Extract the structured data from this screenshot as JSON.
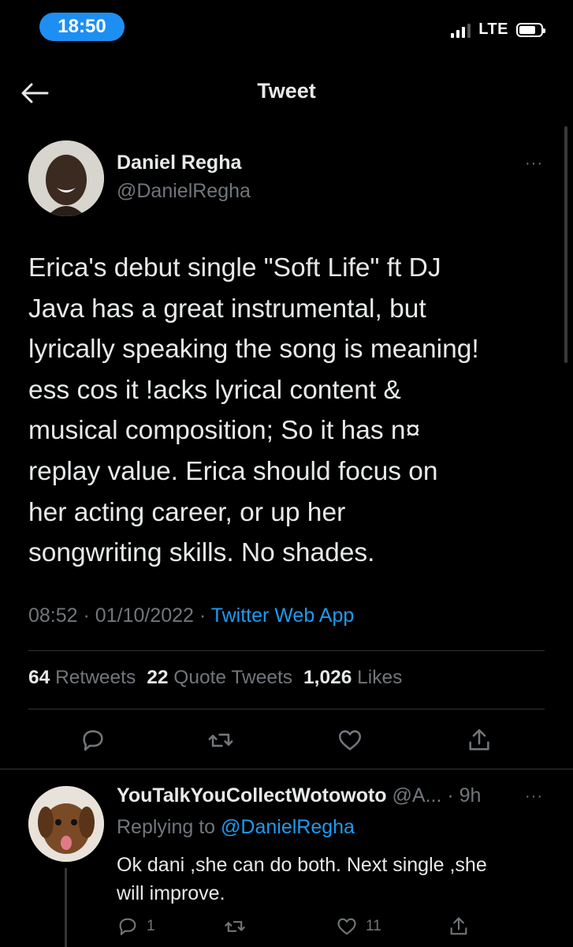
{
  "status_bar": {
    "time": "18:50",
    "network": "LTE"
  },
  "header": {
    "title": "Tweet"
  },
  "tweet": {
    "author_name": "Daniel Regha",
    "author_handle": "@DanielRegha",
    "text_lines": [
      "Erica's debut single \"Soft Life\" ft DJ",
      "Java has a great instrumental, but",
      "lyrically speaking the song is meaning!",
      "ess cos it !acks lyrical content &",
      "musical composition; So it has n¤",
      "replay value. Erica should focus on",
      "her acting career, or up her",
      "songwriting skills. No shades."
    ],
    "time": "08:52",
    "date": "01/10/2022",
    "separator": "·",
    "source": "Twitter Web App",
    "stats": {
      "retweets_count": "64",
      "retweets_label": "Retweets",
      "quotes_count": "22",
      "quotes_label": "Quote Tweets",
      "likes_count": "1,026",
      "likes_label": "Likes"
    },
    "more": "···"
  },
  "reply": {
    "author_name": "YouTalkYouCollectWotowoto",
    "author_handle": "@A...",
    "age": "· 9h",
    "replying_prefix": "Replying to",
    "replying_mention": "@DanielRegha",
    "text_lines": [
      "Ok dani ,she can do both. Next single ,she",
      "will improve."
    ],
    "reply_count": "1",
    "like_count": "11",
    "more": "···"
  },
  "colors": {
    "accent": "#1d9bf0",
    "muted": "#71767b",
    "text": "#e7e9ea",
    "background": "#000000"
  }
}
